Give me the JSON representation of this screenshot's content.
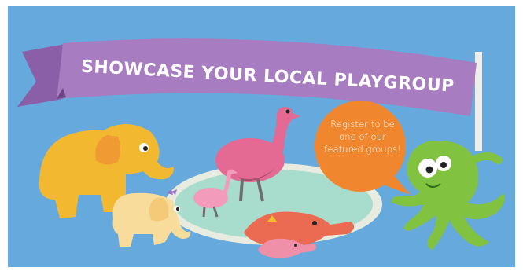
{
  "banner": {
    "title": "SHOWCASE YOUR LOCAL PLAYGROUP"
  },
  "bubble": {
    "lines": [
      "Register to be",
      "one of our",
      "featured groups!"
    ]
  },
  "colors": {
    "background": "#66a9dc",
    "banner": "#a77cc0",
    "banner_dark": "#8a5fa8",
    "bubble": "#f0872f",
    "pond": "#a8dccd",
    "pond_rim": "#e8ece0",
    "elephant": "#f2b830",
    "elephant_baby": "#f8dc9c",
    "emu": "#e56a93",
    "emu_baby": "#f29bbb",
    "platypus": "#ea6b52",
    "octopus": "#82c241"
  },
  "icons": [
    "elephant-icon",
    "baby-elephant-icon",
    "emu-icon",
    "baby-emu-icon",
    "platypus-icon",
    "baby-platypus-icon",
    "octopus-icon",
    "flag-pole-icon"
  ]
}
